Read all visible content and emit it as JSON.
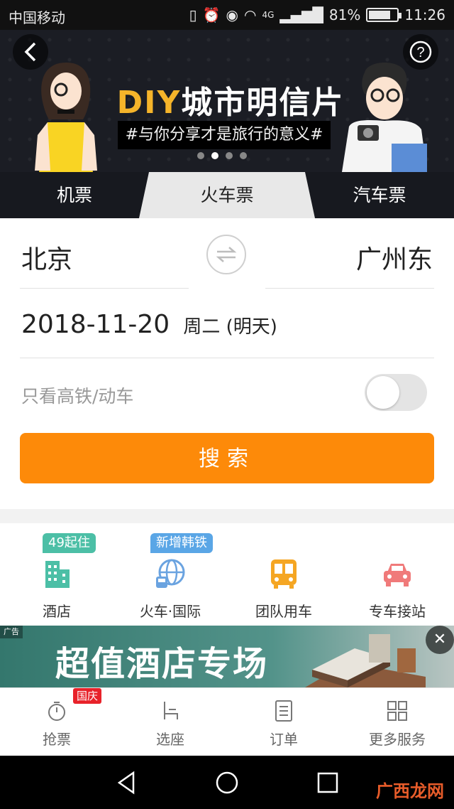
{
  "status_bar": {
    "carrier": "中国移动",
    "network": "4G",
    "battery": "81%",
    "time": "11:26"
  },
  "banner": {
    "title_accent": "DIY",
    "title_rest": "城市明信片",
    "subtitle": "#与你分享才是旅行的意义#",
    "slide_count": 4,
    "active_slide": 2
  },
  "tabs": [
    {
      "label": "机票",
      "active": false
    },
    {
      "label": "火车票",
      "active": true
    },
    {
      "label": "汽车票",
      "active": false
    }
  ],
  "form": {
    "from_city": "北京",
    "to_city": "广州东",
    "date": "2018-11-20",
    "date_extra": "周二 (明天)",
    "high_speed_label": "只看高铁/动车",
    "high_speed_on": false,
    "search_label": "搜索"
  },
  "services": [
    {
      "label": "酒店",
      "badge": "49起住",
      "icon": "hotel-icon",
      "color": "#4cbfa6",
      "badge_color": "#4cbfa6"
    },
    {
      "label": "火车·国际",
      "badge": "新增韩铁",
      "icon": "globe-train-icon",
      "color": "#6aa3e0",
      "badge_color": "#5aa6e6"
    },
    {
      "label": "团队用车",
      "badge": "",
      "icon": "bus-icon",
      "color": "#f5a623"
    },
    {
      "label": "专车接站",
      "badge": "",
      "icon": "car-icon",
      "color": "#f07a7a"
    }
  ],
  "ad": {
    "tag": "广告",
    "text": "超值酒店专场"
  },
  "bottom_tabs": [
    {
      "label": "抢票",
      "icon": "stopwatch-icon",
      "badge": "国庆"
    },
    {
      "label": "选座",
      "icon": "seat-icon"
    },
    {
      "label": "订单",
      "icon": "order-list-icon"
    },
    {
      "label": "更多服务",
      "icon": "grid-icon"
    }
  ],
  "watermark": "广西龙网",
  "colors": {
    "accent": "#fd8a09",
    "banner_bg": "#1b1d24",
    "title_accent": "#f5b42a"
  }
}
